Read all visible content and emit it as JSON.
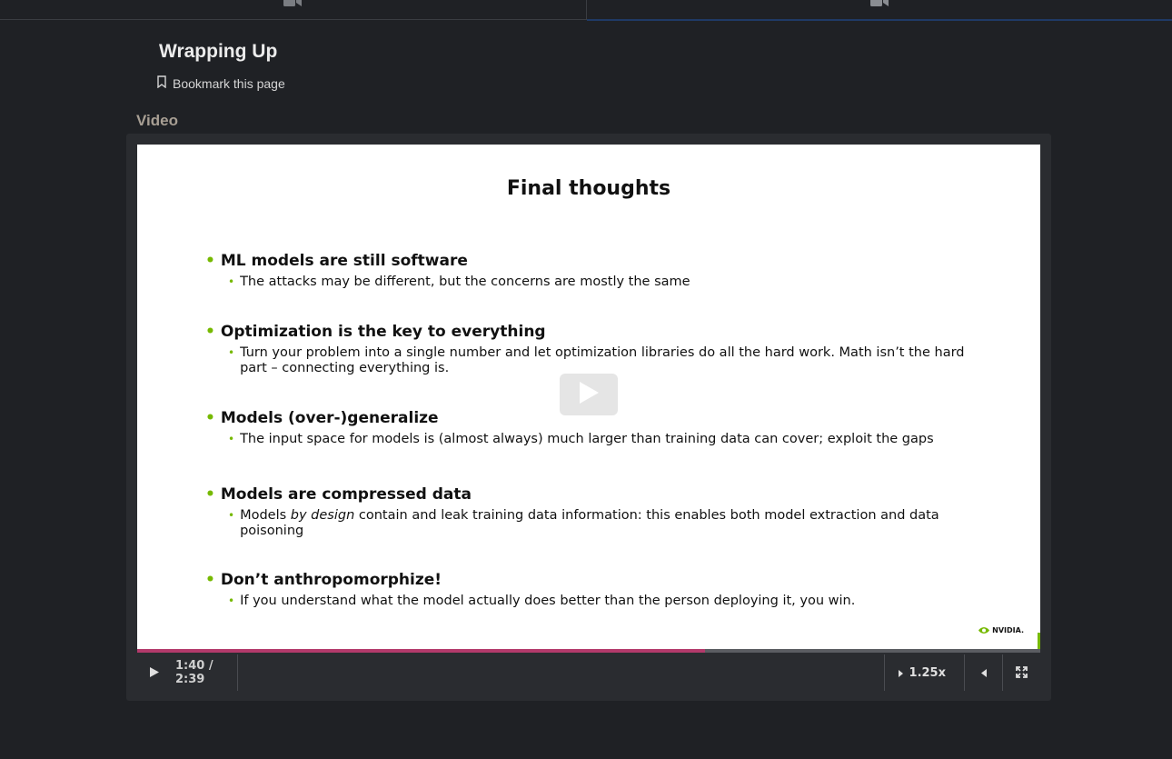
{
  "tabs": [
    {
      "icon": "video-camera-icon"
    },
    {
      "icon": "video-camera-icon"
    }
  ],
  "page": {
    "title": "Wrapping Up",
    "bookmark_label": "Bookmark this page",
    "section_label": "Video"
  },
  "slide": {
    "title": "Final thoughts",
    "bullets": [
      {
        "head": "ML models are still software",
        "sub": "The attacks may be different, but the concerns are mostly the same"
      },
      {
        "head": "Optimization is the key to everything",
        "sub": "Turn your problem into a single number and let optimization libraries do all the hard work. Math isn’t the hard part – connecting everything is."
      },
      {
        "head": "Models (over-)generalize",
        "sub": "The input space for models is (almost always) much larger than training data can cover; exploit the gaps"
      },
      {
        "head": "Models are compressed data",
        "sub_pre": "Models ",
        "sub_em": "by design",
        "sub_post": " contain and leak training data information: this enables both model extraction and data poisoning"
      },
      {
        "head": "Don’t anthropomorphize!",
        "sub": "If you understand what the model actually does better than the person deploying it, you win."
      }
    ],
    "logo_text": "NVIDIA."
  },
  "player": {
    "current_time": "1:40",
    "duration": "2:39",
    "time_display": "1:40 / 2:39",
    "progress_fraction": 0.629,
    "speed": "1.25x",
    "accent_color": "#b33a6b"
  }
}
